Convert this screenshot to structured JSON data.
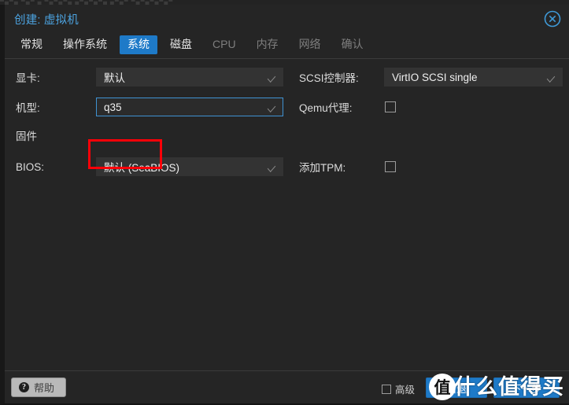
{
  "background_strip": {
    "text": "▀▄▀▄ ▀▄▀ ▄ ▀▄▀▄▀▄ ▄▀▄▀▄▀▄ ▄▀▄▀ ▀▄▀▄▀▄▀▄▀"
  },
  "dialog": {
    "title": "创建: 虚拟机",
    "close_icon": "close-icon"
  },
  "tabs": [
    {
      "label": "常规",
      "active": false,
      "enabled": true
    },
    {
      "label": "操作系统",
      "active": false,
      "enabled": true
    },
    {
      "label": "系统",
      "active": true,
      "enabled": true
    },
    {
      "label": "磁盘",
      "active": false,
      "enabled": true
    },
    {
      "label": "CPU",
      "active": false,
      "enabled": false
    },
    {
      "label": "内存",
      "active": false,
      "enabled": false
    },
    {
      "label": "网络",
      "active": false,
      "enabled": false
    },
    {
      "label": "确认",
      "active": false,
      "enabled": false
    }
  ],
  "form": {
    "left": {
      "graphic_card": {
        "label": "显卡:",
        "value": "默认"
      },
      "machine": {
        "label": "机型:",
        "value": "q35",
        "focused": true,
        "highlighted": true
      },
      "firmware": {
        "label": "固件"
      },
      "bios": {
        "label": "BIOS:",
        "value": "默认 (SeaBIOS)"
      }
    },
    "right": {
      "scsi_controller": {
        "label": "SCSI控制器:",
        "value": "VirtIO SCSI single"
      },
      "qemu_agent": {
        "label": "Qemu代理:",
        "checked": false
      },
      "add_tpm": {
        "label": "添加TPM:",
        "checked": false
      }
    }
  },
  "footer": {
    "help_label": "帮助",
    "help_icon": "question-mark-icon",
    "advanced_label": "高级",
    "advanced_checked": false,
    "back_label": "后退",
    "next_label": "下一步"
  },
  "watermark": {
    "badge": "值",
    "text": "什么值得买"
  },
  "colors": {
    "accent_blue": "#1e7ac8",
    "title_blue": "#4ca3e0",
    "annotation_red": "#fb0008",
    "dialog_bg": "#252525",
    "field_bg": "#333333"
  }
}
